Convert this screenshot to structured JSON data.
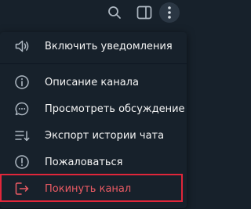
{
  "topbar": {
    "icons": [
      "search-icon",
      "sidebar-toggle-icon",
      "more-vertical-icon"
    ]
  },
  "menu": {
    "items": [
      {
        "label": "Включить уведомления",
        "icon": "speaker-icon"
      },
      {
        "label": "Описание канала",
        "icon": "info-icon"
      },
      {
        "label": "Просмотреть обсуждение",
        "icon": "chat-bubble-icon"
      },
      {
        "label": "Экспорт истории чата",
        "icon": "export-list-icon"
      },
      {
        "label": "Пожаловаться",
        "icon": "report-icon"
      },
      {
        "label": "Покинуть канал",
        "icon": "leave-icon"
      }
    ]
  },
  "colors": {
    "background": "#17212b",
    "text": "#f5f5f5",
    "icon": "#aeb8c2",
    "danger": "#ec5b64",
    "highlight_border": "#e0263a"
  }
}
